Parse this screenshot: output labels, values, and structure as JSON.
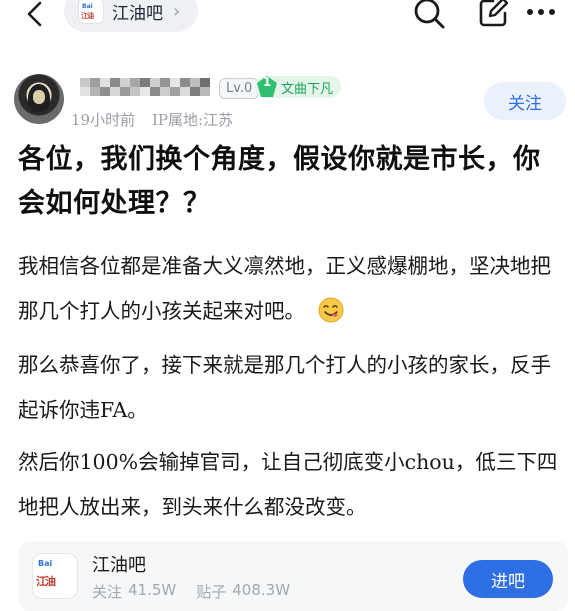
{
  "topbar": {
    "forum_name": "江油吧",
    "chevron": "›"
  },
  "post": {
    "level": "Lv.0",
    "badge_number": "1",
    "badge_label": "文曲下凡",
    "time": "19小时前",
    "ip_location": "IP属地:江苏",
    "follow_label": "关注",
    "title": "各位，我们换个角度，假设你就是市长，你会如何处理？？",
    "paragraphs": [
      "我相信各位都是准备大义凛然地，正义感爆棚地，坚决地把那几个打人的小孩关起来对吧。",
      "那么恭喜你了，接下来就是那几个打人的小孩的家长，反手起诉你违FA。",
      "然后你100%会输掉官司，让自己彻底变小chou，低三下四地把人放出来，到头来什么都没改变。"
    ]
  },
  "forum_card": {
    "name": "江油吧",
    "followers_label": "关注",
    "followers_value": "41.5W",
    "posts_label": "贴子",
    "posts_value": "408.3W",
    "enter_label": "进吧"
  },
  "icons": {
    "back": "back-chevron-icon",
    "search": "search-icon",
    "edit": "edit-icon",
    "more": "more-icon",
    "emoji": "savoring-face-emoji-icon"
  },
  "colors": {
    "accent": "#2f6fe4",
    "badge_green": "#20a15a",
    "meta_gray": "#9a9ea6"
  }
}
